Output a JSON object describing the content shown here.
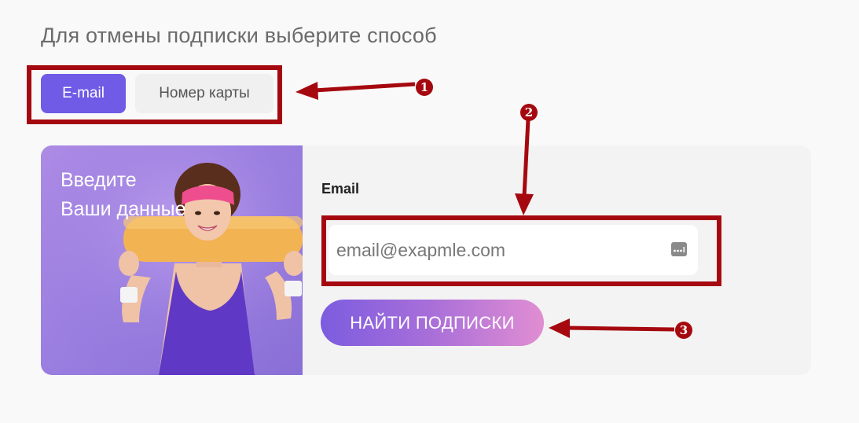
{
  "heading": "Для отмены подписки выберите способ",
  "tabs": [
    {
      "label": "E-mail",
      "active": true
    },
    {
      "label": "Номер карты",
      "active": false
    }
  ],
  "card": {
    "image_text_line1": "Введите",
    "image_text_line2": "Ваши данные",
    "field_label": "Email",
    "email_placeholder": "email@exapmle.com",
    "submit_label": "НАЙТИ ПОДПИСКИ"
  },
  "annotations": {
    "markers": [
      "1",
      "2",
      "3"
    ],
    "color": "#a5090f"
  },
  "colors": {
    "accent": "#6f5be6",
    "button_gradient_start": "#7c5cdf",
    "button_gradient_end": "#e18ed2",
    "image_bg": "#9a7ee0"
  }
}
